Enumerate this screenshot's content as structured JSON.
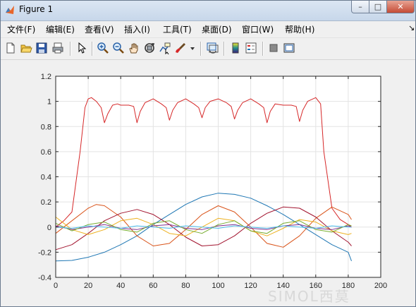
{
  "window": {
    "title": "Figure 1"
  },
  "window_buttons": {
    "minimize": "–",
    "maximize": "□",
    "close": "✕"
  },
  "menu": [
    {
      "label": "文件(F)"
    },
    {
      "label": "编辑(E)"
    },
    {
      "label": "查看(V)"
    },
    {
      "label": "插入(I)"
    },
    {
      "label": "工具(T)"
    },
    {
      "label": "桌面(D)"
    },
    {
      "label": "窗口(W)"
    },
    {
      "label": "帮助(H)"
    }
  ],
  "toolbar_icons": [
    "new-file-icon",
    "open-folder-icon",
    "save-icon",
    "print-icon",
    "pointer-icon",
    "zoom-in-icon",
    "zoom-out-icon",
    "pan-hand-icon",
    "rotate-3d-icon",
    "data-cursor-icon",
    "brush-icon",
    "brush-dropdown-icon",
    "link-plot-icon",
    "colorbar-icon",
    "legend-icon",
    "hide-plot-tools-icon",
    "show-plot-tools-icon"
  ],
  "watermark": "SIMOL西莫",
  "chart_data": {
    "type": "line",
    "title": "",
    "xlabel": "",
    "ylabel": "",
    "xlim": [
      0,
      200
    ],
    "ylim": [
      -0.4,
      1.2
    ],
    "xticks": [
      "0",
      "20",
      "40",
      "60",
      "80",
      "100",
      "120",
      "140",
      "160",
      "180",
      "200"
    ],
    "yticks": [
      "-0.4",
      "-0.2",
      "0",
      "0.2",
      "0.4",
      "0.6",
      "0.8",
      "1",
      "1.2"
    ],
    "grid": true,
    "colors": {
      "red": "#d62728",
      "blue": "#1f77b4",
      "orange": "#d95319",
      "yellow": "#edb120",
      "purple": "#7e2f8e",
      "green": "#77ac30",
      "cyan": "#4dbeee",
      "darkred": "#a2142f"
    },
    "series": [
      {
        "color": "red",
        "x": [
          0,
          5,
          10,
          15,
          18,
          20,
          22,
          25,
          28,
          30,
          32,
          35,
          38,
          40,
          45,
          48,
          50,
          52,
          55,
          60,
          65,
          68,
          70,
          72,
          75,
          80,
          85,
          88,
          90,
          92,
          95,
          100,
          105,
          108,
          110,
          112,
          115,
          120,
          125,
          128,
          130,
          132,
          135,
          140,
          145,
          148,
          150,
          152,
          155,
          160,
          163,
          165,
          170,
          175,
          180,
          182
        ],
        "y": [
          0.0,
          0.05,
          0.12,
          0.6,
          0.95,
          1.02,
          1.03,
          1.0,
          0.95,
          0.83,
          0.9,
          0.97,
          0.98,
          0.97,
          0.97,
          0.96,
          0.83,
          0.92,
          0.99,
          1.02,
          0.98,
          0.95,
          0.85,
          0.93,
          0.99,
          1.02,
          0.98,
          0.95,
          0.87,
          0.95,
          1.0,
          1.02,
          0.99,
          0.96,
          0.86,
          0.93,
          0.99,
          1.02,
          0.98,
          0.95,
          0.83,
          0.92,
          0.98,
          0.97,
          0.97,
          0.96,
          0.84,
          0.93,
          1.0,
          1.03,
          0.98,
          0.6,
          0.15,
          0.06,
          0.02,
          0.0
        ]
      },
      {
        "color": "blue",
        "x": [
          0,
          10,
          20,
          30,
          40,
          50,
          60,
          70,
          80,
          90,
          100,
          110,
          120,
          130,
          140,
          150,
          160,
          170,
          180,
          182
        ],
        "y": [
          -0.27,
          -0.265,
          -0.24,
          -0.2,
          -0.14,
          -0.07,
          0.02,
          0.1,
          0.18,
          0.24,
          0.27,
          0.26,
          0.23,
          0.17,
          0.1,
          0.02,
          -0.06,
          -0.14,
          -0.2,
          -0.27
        ]
      },
      {
        "color": "orange",
        "x": [
          0,
          10,
          20,
          25,
          30,
          40,
          50,
          60,
          70,
          80,
          90,
          100,
          110,
          120,
          130,
          140,
          150,
          160,
          170,
          180,
          182
        ],
        "y": [
          -0.05,
          0.05,
          0.15,
          0.18,
          0.17,
          0.08,
          -0.07,
          -0.15,
          -0.13,
          -0.02,
          0.1,
          0.17,
          0.12,
          0.0,
          -0.13,
          -0.16,
          -0.07,
          0.07,
          0.16,
          0.1,
          0.06
        ]
      },
      {
        "color": "darkred",
        "x": [
          0,
          10,
          20,
          30,
          40,
          50,
          60,
          70,
          80,
          90,
          100,
          110,
          120,
          130,
          140,
          150,
          160,
          170,
          180,
          182
        ],
        "y": [
          -0.18,
          -0.14,
          -0.05,
          0.05,
          0.11,
          0.14,
          0.1,
          0.02,
          -0.08,
          -0.15,
          -0.14,
          -0.07,
          0.03,
          0.11,
          0.16,
          0.15,
          0.08,
          -0.03,
          -0.12,
          -0.15
        ]
      },
      {
        "color": "yellow",
        "x": [
          0,
          10,
          20,
          30,
          40,
          50,
          60,
          70,
          80,
          90,
          100,
          110,
          120,
          130,
          140,
          150,
          160,
          170,
          180,
          182
        ],
        "y": [
          0.08,
          -0.02,
          -0.06,
          -0.02,
          0.05,
          0.07,
          0.02,
          -0.05,
          -0.07,
          0.0,
          0.07,
          0.05,
          -0.03,
          -0.07,
          -0.01,
          0.06,
          0.04,
          -0.03,
          -0.06,
          -0.05
        ]
      },
      {
        "color": "purple",
        "x": [
          0,
          10,
          20,
          30,
          40,
          50,
          60,
          70,
          80,
          90,
          100,
          110,
          120,
          130,
          140,
          150,
          160,
          170,
          180,
          182
        ],
        "y": [
          0.01,
          -0.02,
          0.0,
          0.02,
          -0.01,
          -0.02,
          0.01,
          0.02,
          -0.01,
          -0.02,
          0.01,
          0.02,
          -0.01,
          -0.02,
          0.01,
          0.02,
          -0.01,
          -0.02,
          0.01,
          0.0
        ]
      },
      {
        "color": "green",
        "x": [
          0,
          10,
          20,
          30,
          40,
          50,
          60,
          70,
          80,
          90,
          100,
          110,
          120,
          130,
          140,
          150,
          160,
          170,
          180,
          182
        ],
        "y": [
          0.03,
          -0.03,
          0.02,
          0.04,
          -0.02,
          -0.04,
          0.03,
          0.05,
          -0.02,
          -0.05,
          0.02,
          0.05,
          -0.03,
          -0.05,
          0.03,
          0.05,
          -0.02,
          -0.04,
          0.02,
          0.01
        ]
      },
      {
        "color": "cyan",
        "x": [
          0,
          10,
          20,
          30,
          40,
          50,
          60,
          70,
          80,
          90,
          100,
          110,
          120,
          130,
          140,
          150,
          160,
          170,
          180,
          182
        ],
        "y": [
          0.0,
          -0.01,
          0.01,
          0.0,
          -0.01,
          0.01,
          0.0,
          -0.01,
          0.01,
          0.0,
          -0.01,
          0.01,
          0.0,
          -0.01,
          0.01,
          0.0,
          -0.01,
          0.01,
          0.0,
          0.0
        ]
      }
    ]
  }
}
